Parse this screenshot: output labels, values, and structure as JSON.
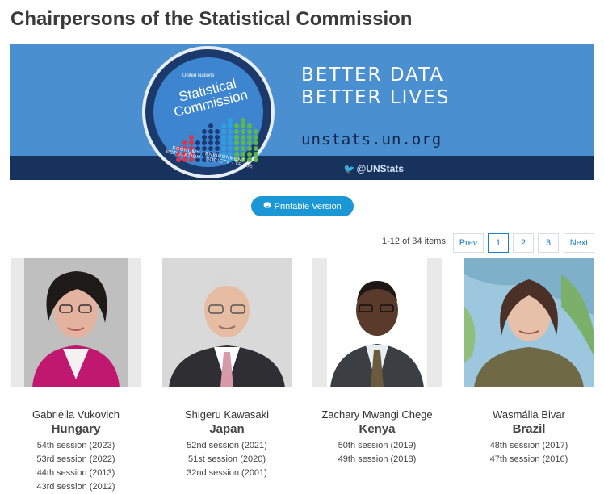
{
  "page": {
    "title": "Chairpersons of the Statistical Commission"
  },
  "banner": {
    "un_label": "United Nations",
    "seal_title": "Statistical Commission",
    "seal_arc": "ECONOMY · ENVIRONMENT · POPULATION · SOCIETY · TRADE",
    "slogan_line1": "BETTER DATA",
    "slogan_line2": "BETTER LIVES",
    "url": "unstats.un.org",
    "twitter_handle": "@UNStats",
    "colors": {
      "background": "#4a8fd0",
      "strip": "#17325c",
      "seal": "#1b3a6b"
    }
  },
  "actions": {
    "printable_label": "Printable Version",
    "print_icon": "printer-icon"
  },
  "pagination": {
    "items_text": "1-12 of 34 items",
    "prev_label": "Prev",
    "pages": [
      "1",
      "2",
      "3"
    ],
    "current_page": "1",
    "next_label": "Next"
  },
  "chairpersons": [
    {
      "name": "Gabriella Vukovich",
      "country": "Hungary",
      "sessions": [
        "54th session (2023)",
        "53rd session (2022)",
        "44th session (2013)",
        "43rd session (2012)"
      ]
    },
    {
      "name": "Shigeru Kawasaki",
      "country": "Japan",
      "sessions": [
        "52nd session (2021)",
        "51st session (2020)",
        "32nd session (2001)"
      ]
    },
    {
      "name": "Zachary Mwangi Chege",
      "country": "Kenya",
      "sessions": [
        "50th session (2019)",
        "49th session (2018)"
      ]
    },
    {
      "name": "Wasmália Bivar",
      "country": "Brazil",
      "sessions": [
        "48th session (2017)",
        "47th session (2016)"
      ]
    }
  ]
}
